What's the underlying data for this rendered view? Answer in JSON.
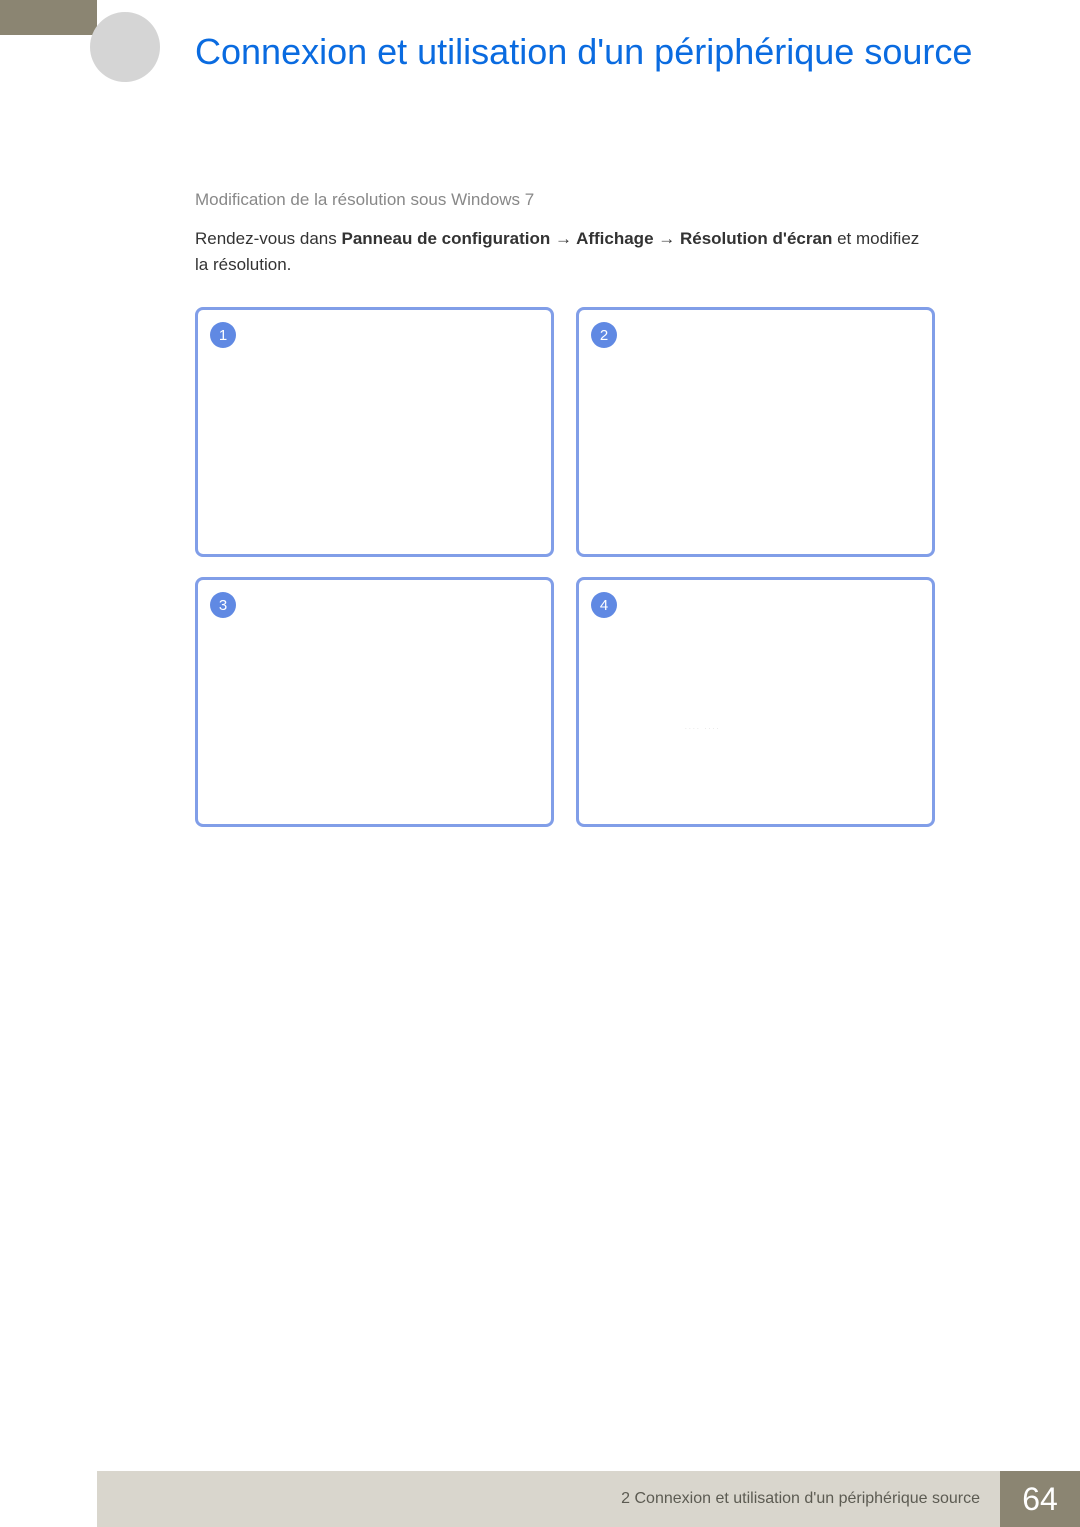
{
  "header": {
    "title": "Connexion et utilisation d'un périphérique source"
  },
  "content": {
    "section_heading": "Modification de la résolution sous Windows 7",
    "intro_prefix": "Rendez-vous dans ",
    "path_part1": "Panneau de configuration",
    "arrow": " → ",
    "path_part2": "Affichage",
    "path_part3": "Résolution d'écran",
    "intro_suffix": " et modifiez la résolution."
  },
  "steps": {
    "box1": "1",
    "box2": "2",
    "box3": "3",
    "box4": "4"
  },
  "footer": {
    "chapter_label": "2 Connexion et utilisation d'un périphérique source",
    "page_number": "64"
  }
}
